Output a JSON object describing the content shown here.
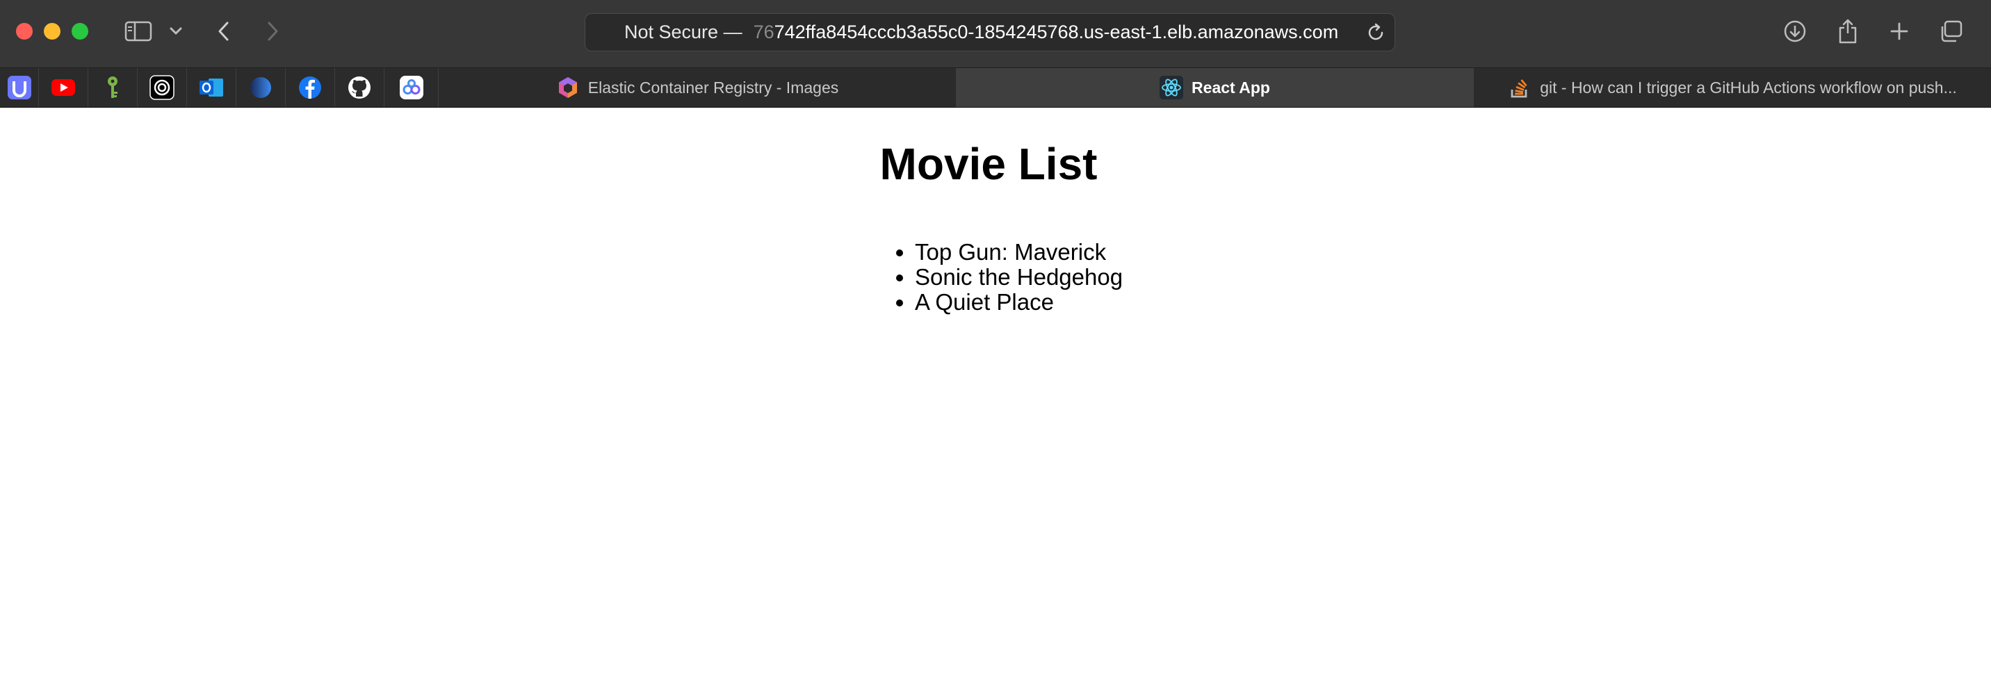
{
  "browser": {
    "address": {
      "security": "Not Secure —",
      "host_prefix": "76",
      "host": "742ffa8454cccb3a55c0-1854245768.us-east-1.elb.amazonaws.com"
    },
    "pinned_tabs": [
      {
        "icon": "udacity-icon",
        "color": "#5c6bff"
      },
      {
        "icon": "youtube-icon",
        "color": "#ff0000"
      },
      {
        "icon": "key-icon",
        "color": "#7ab648"
      },
      {
        "icon": "openai-icon",
        "color": "#ffffff"
      },
      {
        "icon": "outlook-icon",
        "color": "#0a64d8"
      },
      {
        "icon": "globe-dark-icon",
        "color": "#2a6de0"
      },
      {
        "icon": "facebook-icon",
        "color": "#1877f2"
      },
      {
        "icon": "github-icon",
        "color": "#ffffff"
      },
      {
        "icon": "infinity-icon",
        "color": "#4a8cf7"
      }
    ],
    "tabs": [
      {
        "label": "Elastic Container Registry - Images",
        "active": false
      },
      {
        "label": "React App",
        "active": true
      },
      {
        "label": "git - How can I trigger a GitHub Actions workflow on push...",
        "active": false
      }
    ]
  },
  "page": {
    "title": "Movie List",
    "movies": [
      "Top Gun: Maverick",
      "Sonic the Hedgehog",
      "A Quiet Place"
    ]
  }
}
